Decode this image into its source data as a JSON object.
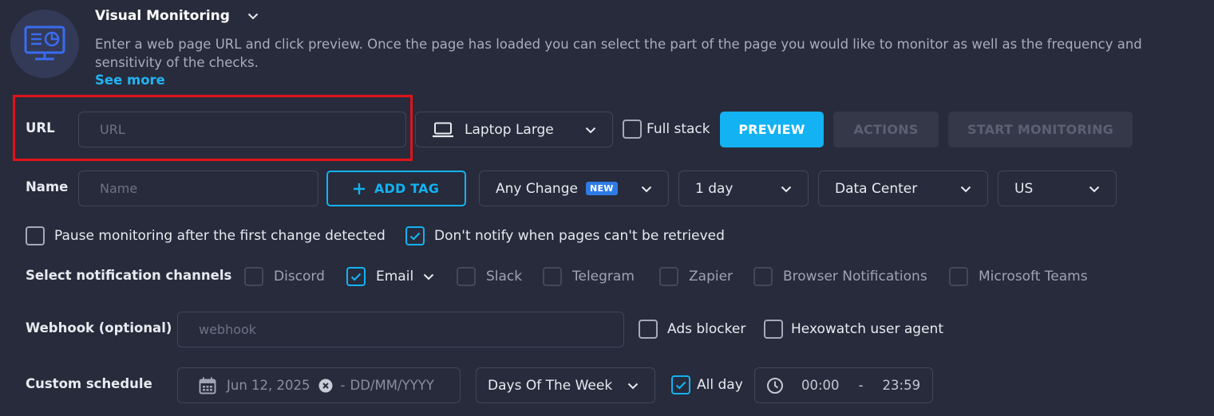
{
  "header": {
    "title": "Visual Monitoring",
    "description": "Enter a web page URL and click preview. Once the page has loaded you can select the part of the page you would like to monitor as well as the frequency and sensitivity of the checks.",
    "see_more": "See more"
  },
  "row_url": {
    "label": "URL",
    "url_placeholder": "URL",
    "device": "Laptop Large",
    "full_stack_label": "Full stack",
    "preview_label": "PREVIEW",
    "actions_label": "ACTIONS",
    "start_label": "START MONITORING"
  },
  "row_name": {
    "label": "Name",
    "name_placeholder": "Name",
    "add_tag_label": "ADD TAG",
    "change_type": "Any Change",
    "new_badge": "NEW",
    "frequency": "1 day",
    "source": "Data Center",
    "region": "US"
  },
  "options": {
    "pause_label": "Pause monitoring after the first change detected",
    "pause_checked": false,
    "dont_notify_label": "Don't notify when pages can't be retrieved",
    "dont_notify_checked": true
  },
  "channels": {
    "label": "Select notification channels",
    "items": [
      {
        "label": "Discord",
        "checked": false
      },
      {
        "label": "Email",
        "checked": true
      },
      {
        "label": "Slack",
        "checked": false
      },
      {
        "label": "Telegram",
        "checked": false
      },
      {
        "label": "Zapier",
        "checked": false
      },
      {
        "label": "Browser Notifications",
        "checked": false
      },
      {
        "label": "Microsoft Teams",
        "checked": false
      }
    ]
  },
  "webhook": {
    "label": "Webhook (optional)",
    "placeholder": "webhook",
    "ads_blocker_label": "Ads blocker",
    "user_agent_label": "Hexowatch user agent"
  },
  "schedule": {
    "label": "Custom schedule",
    "start_date": "Jun 12, 2025",
    "separator": "-",
    "end_placeholder": "DD/MM/YYYY",
    "days_mode": "Days Of The Week",
    "all_day_label": "All day",
    "all_day_checked": true,
    "time_start": "00:00",
    "time_separator": "-",
    "time_end": "23:59"
  },
  "colors": {
    "background": "#272b3b",
    "accent": "#13b2f2",
    "highlight": "#e01418",
    "badge": "#2f7be5"
  }
}
